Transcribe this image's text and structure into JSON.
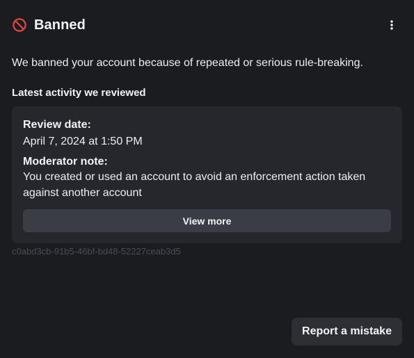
{
  "header": {
    "title": "Banned",
    "status_icon": "ban-icon",
    "menu_icon": "more-vertical-icon"
  },
  "colors": {
    "ban_red": "#e5483f",
    "background": "#1b1c20",
    "card": "#25272d",
    "button": "#3a3d45"
  },
  "description": "We banned your account because of repeated or serious rule-breaking.",
  "activity": {
    "heading": "Latest activity we reviewed",
    "review_date_label": "Review date:",
    "review_date_value": "April 7, 2024 at 1:50 PM",
    "moderator_note_label": "Moderator note:",
    "moderator_note_value": "You created or used an account to avoid an enforcement action taken against another account",
    "view_more_label": "View more"
  },
  "reference_id": "c0abd3cb-91b5-46bf-bd48-52227ceab3d5",
  "actions": {
    "report_label": "Report a mistake"
  }
}
